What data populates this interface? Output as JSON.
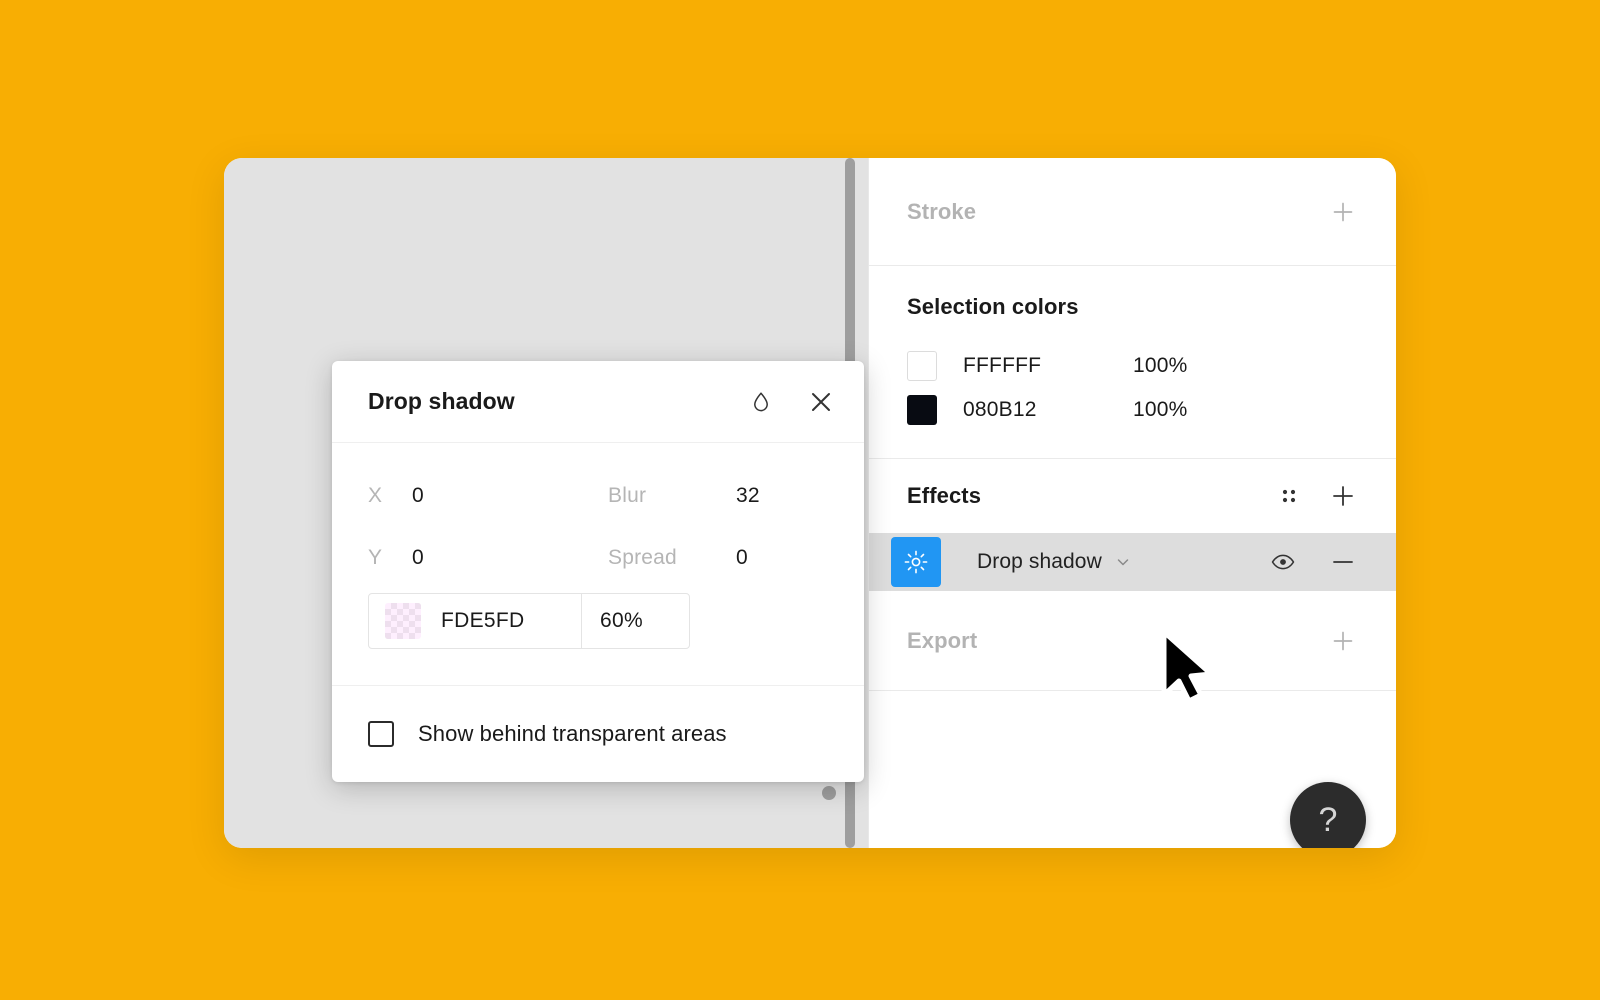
{
  "theme": {
    "background": "#F8AE03",
    "canvas": "#E2E2E2",
    "panel": "#FFFFFF",
    "accent_blue": "#2196F3",
    "row_highlight": "#DDDDDD",
    "help_bubble": "#2C2C2C",
    "text_primary": "#1A1A1A",
    "text_muted": "#B3B3B3"
  },
  "panel": {
    "stroke": {
      "title": "Stroke",
      "add_icon": "plus-icon"
    },
    "selection_colors": {
      "title": "Selection colors",
      "rows": [
        {
          "hex": "FFFFFF",
          "swatch": "#FFFFFF",
          "opacity": "100%"
        },
        {
          "hex": "080B12",
          "swatch": "#080B12",
          "opacity": "100%"
        }
      ]
    },
    "effects": {
      "title": "Effects",
      "styles_icon": "four-dot-grid-icon",
      "add_icon": "plus-icon",
      "rows": [
        {
          "swatch_icon": "sun-brightness-icon",
          "name": "Drop shadow",
          "chevron_icon": "chevron-down-icon",
          "visibility_icon": "eye-icon",
          "remove_icon": "minus-icon"
        }
      ]
    },
    "export": {
      "title": "Export",
      "add_icon": "plus-icon"
    },
    "help": {
      "label": "?",
      "icon": "question-mark-icon"
    }
  },
  "dialog": {
    "title": "Drop shadow",
    "droplet_icon": "droplet-icon",
    "close_icon": "close-icon",
    "fields": {
      "x_label": "X",
      "x_value": "0",
      "blur_label": "Blur",
      "blur_value": "32",
      "y_label": "Y",
      "y_value": "0",
      "spread_label": "Spread",
      "spread_value": "0"
    },
    "color": {
      "swatch": "#FDE5FD",
      "hex": "FDE5FD",
      "opacity": "60%"
    },
    "footer": {
      "checkbox_label": "Show behind transparent areas",
      "checked": false
    }
  },
  "cursor": {
    "icon": "arrow-pointer-cursor"
  }
}
